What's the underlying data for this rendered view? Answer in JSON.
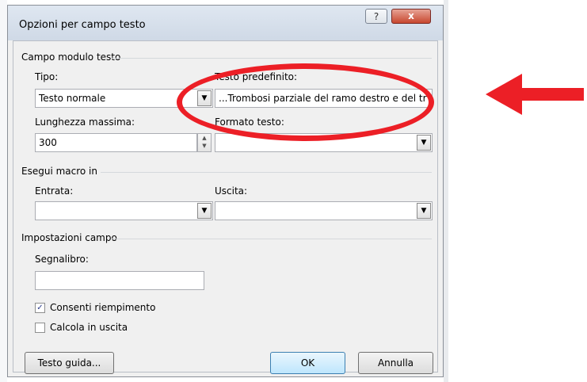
{
  "dialog": {
    "title": "Opzioni per campo testo",
    "help_label": "?",
    "close_label": "x"
  },
  "text_field_group": {
    "title": "Campo modulo testo",
    "type_label": "Tipo:",
    "type_value": "Testo normale",
    "default_text_label": "Testo predefinito:",
    "default_text_value": "...Trombosi parziale del ramo destro e del tr",
    "max_length_label": "Lunghezza massima:",
    "max_length_value": "300",
    "text_format_label": "Formato testo:",
    "text_format_value": ""
  },
  "macro_group": {
    "title": "Esegui macro in",
    "entry_label": "Entrata:",
    "entry_value": "",
    "exit_label": "Uscita:",
    "exit_value": ""
  },
  "settings_group": {
    "title": "Impostazioni campo",
    "bookmark_label": "Segnalibro:",
    "bookmark_value": "",
    "fill_in_label": "Consenti riempimento",
    "fill_in_checked": true,
    "calc_on_exit_label": "Calcola in uscita",
    "calc_on_exit_checked": false
  },
  "buttons": {
    "help_text": "Testo guida...",
    "ok": "OK",
    "cancel": "Annulla"
  },
  "annotation": {
    "color": "#ec1f26"
  },
  "icons": {
    "dropdown": "chevron-down-icon",
    "spinner_up": "spinner-up-icon",
    "spinner_down": "spinner-down-icon",
    "checkbox_check": "check-icon",
    "arrow": "red-arrow-icon"
  }
}
